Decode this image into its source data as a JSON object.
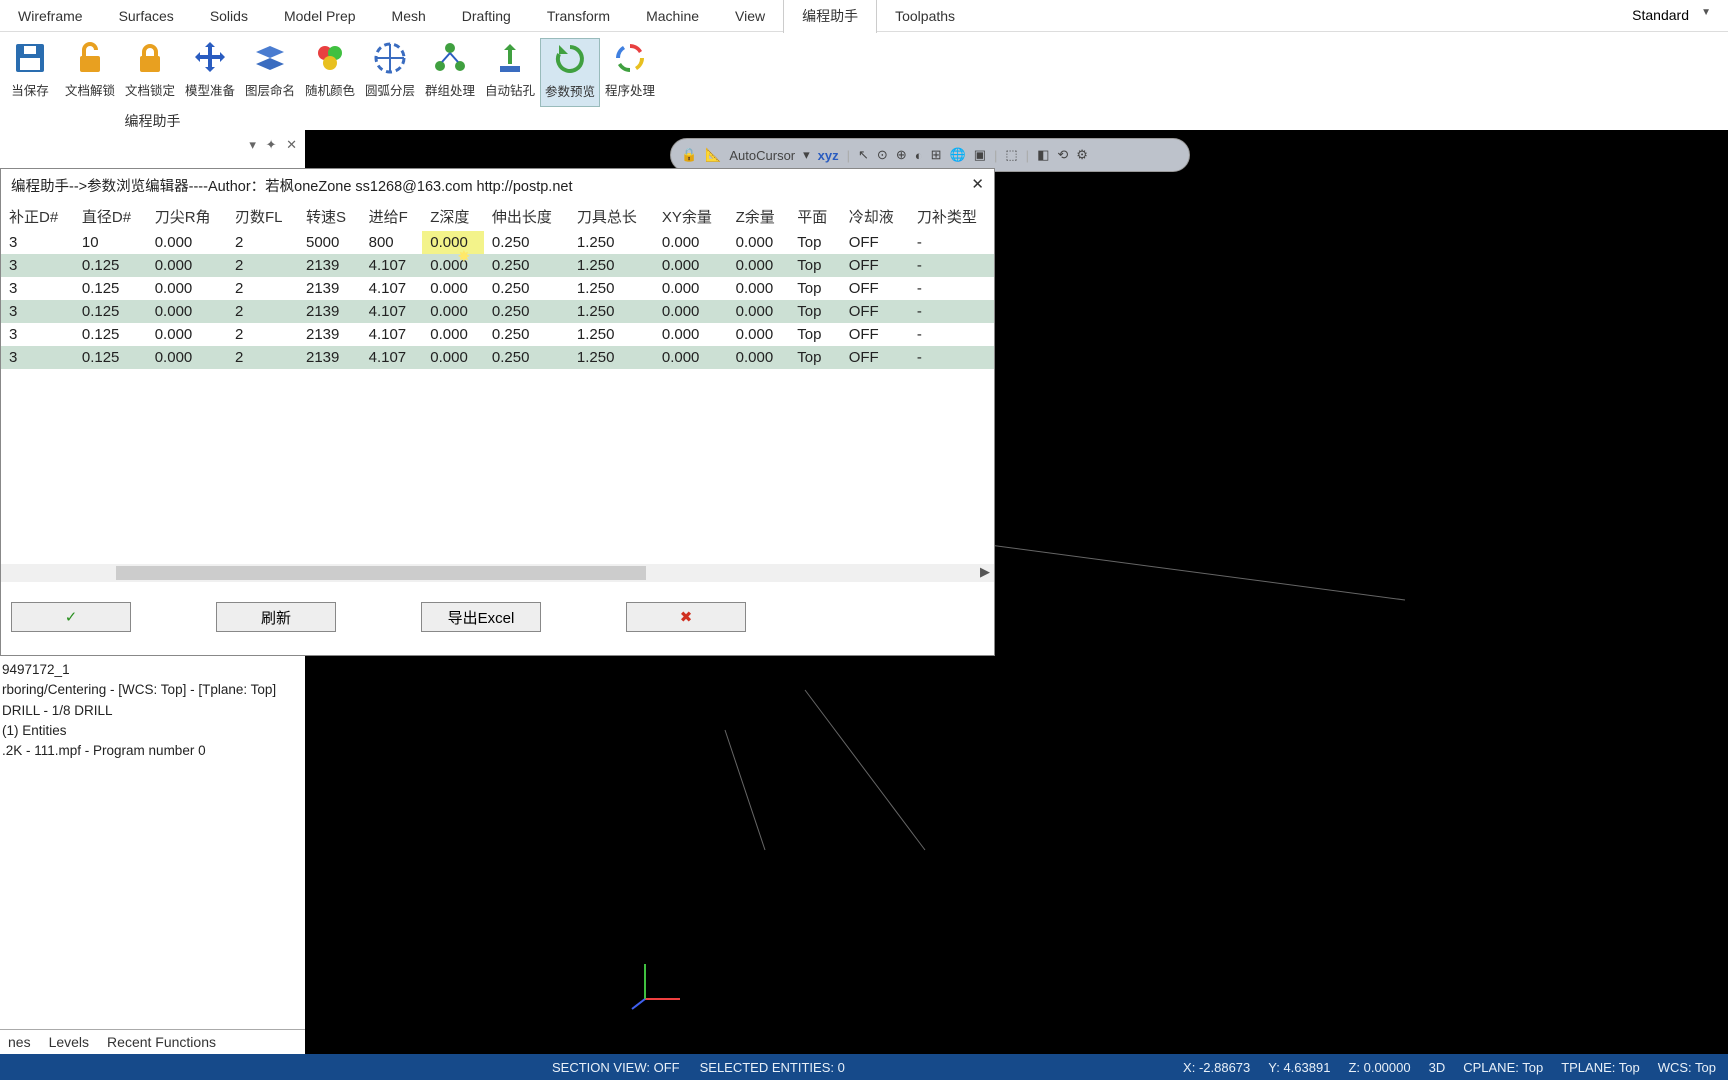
{
  "menubar": {
    "items": [
      "Wireframe",
      "Surfaces",
      "Solids",
      "Model Prep",
      "Mesh",
      "Drafting",
      "Transform",
      "Machine",
      "View",
      "编程助手",
      "Toolpaths"
    ],
    "active_index": 9
  },
  "mode_selector": "Standard",
  "ribbon": {
    "buttons": [
      {
        "label": "当保存"
      },
      {
        "label": "文档解锁"
      },
      {
        "label": "文档锁定"
      },
      {
        "label": "模型准备"
      },
      {
        "label": "图层命名"
      },
      {
        "label": "随机颜色"
      },
      {
        "label": "圆弧分层"
      },
      {
        "label": "群组处理"
      },
      {
        "label": "自动钻孔"
      },
      {
        "label": "参数预览",
        "active": true
      },
      {
        "label": "程序处理"
      }
    ]
  },
  "panel_title": "编程助手",
  "panel_controls": {
    "pin": "▾",
    "pin2": "📌",
    "close": "✕"
  },
  "float_toolbar": {
    "label": "AutoCursor",
    "xyz": "xyz"
  },
  "dialog": {
    "title": "编程助手-->参数浏览编辑器----Author：若枫oneZone  ss1268@163.com http://postp.net",
    "headers": [
      "补正D#",
      "直径D#",
      "刀尖R角",
      "刃数FL",
      "转速S",
      "进给F",
      "Z深度",
      "伸出长度",
      "刀具总长",
      "XY余量",
      "Z余量",
      "平面",
      "冷却液",
      "刀补类型"
    ],
    "rows": [
      [
        "3",
        "10",
        "0.000",
        "2",
        "5000",
        "800",
        "0.000",
        "0.250",
        "1.250",
        "0.000",
        "0.000",
        "Top",
        "OFF",
        "-"
      ],
      [
        "3",
        "0.125",
        "0.000",
        "2",
        "2139",
        "4.107",
        "0.000",
        "0.250",
        "1.250",
        "0.000",
        "0.000",
        "Top",
        "OFF",
        "-"
      ],
      [
        "3",
        "0.125",
        "0.000",
        "2",
        "2139",
        "4.107",
        "0.000",
        "0.250",
        "1.250",
        "0.000",
        "0.000",
        "Top",
        "OFF",
        "-"
      ],
      [
        "3",
        "0.125",
        "0.000",
        "2",
        "2139",
        "4.107",
        "0.000",
        "0.250",
        "1.250",
        "0.000",
        "0.000",
        "Top",
        "OFF",
        "-"
      ],
      [
        "3",
        "0.125",
        "0.000",
        "2",
        "2139",
        "4.107",
        "0.000",
        "0.250",
        "1.250",
        "0.000",
        "0.000",
        "Top",
        "OFF",
        "-"
      ],
      [
        "3",
        "0.125",
        "0.000",
        "2",
        "2139",
        "4.107",
        "0.000",
        "0.250",
        "1.250",
        "0.000",
        "0.000",
        "Top",
        "OFF",
        "-"
      ]
    ],
    "highlight": {
      "row": 0,
      "col": 6
    },
    "buttons": {
      "ok": "✓",
      "refresh": "刷新",
      "export": "导出Excel",
      "cancel": "✖"
    }
  },
  "left_info": {
    "line1": "9497172_1",
    "line2": "rboring/Centering - [WCS: Top] - [Tplane: Top]",
    "line3": "",
    "line4": "DRILL - 1/8 DRILL",
    "line5": "(1) Entities",
    "line6": ".2K - 111.mpf - Program number 0"
  },
  "bottom_tabs": [
    "nes",
    "Levels",
    "Recent Functions"
  ],
  "statusbar": {
    "section_view": "SECTION VIEW: OFF",
    "selected": "SELECTED ENTITIES: 0",
    "x": "X: -2.88673",
    "y": "Y: 4.63891",
    "z": "Z: 0.00000",
    "threed": "3D",
    "cplane": "CPLANE: Top",
    "tplane": "TPLANE: Top",
    "wcs": "WCS: Top"
  }
}
